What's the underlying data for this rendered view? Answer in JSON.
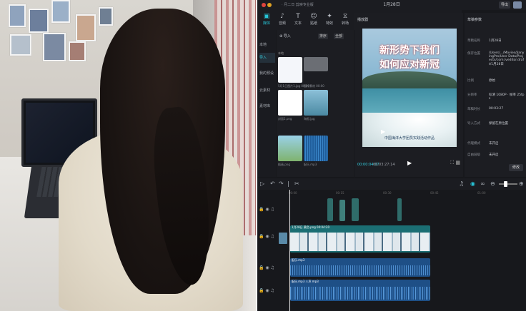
{
  "editor": {
    "window_title": "1月28日",
    "menu_text": "· 月二日  剪映专业版",
    "export_label": "导出",
    "colors": {
      "accent": "#27c3d6",
      "panel": "#1c1d22",
      "bg": "#17181c",
      "track_video": "#1b6e73",
      "track_audio": "#1e4f86"
    },
    "toolbar": {
      "items": [
        {
          "icon": "media-icon",
          "label": "媒体"
        },
        {
          "icon": "audio-icon",
          "label": "音频"
        },
        {
          "icon": "text-icon",
          "label": "文本"
        },
        {
          "icon": "sticker-icon",
          "label": "贴纸"
        },
        {
          "icon": "effects-icon",
          "label": "特效"
        },
        {
          "icon": "transition-icon",
          "label": "转场"
        },
        {
          "icon": "filter-icon",
          "label": "滤镜"
        },
        {
          "icon": "adjust-icon",
          "label": "调节"
        },
        {
          "icon": "template-icon",
          "label": "模板"
        }
      ]
    },
    "leftnav": {
      "items": [
        "本地",
        "导入",
        "我的预设",
        "云素材",
        "素材库"
      ]
    },
    "media": {
      "import_label": "导入",
      "btn_sort": "排序",
      "btn_all": "全部",
      "section": "本地",
      "thumbs": [
        {
          "caption": "5月1日图片1.jpg 00:00"
        },
        {
          "caption": "图片素材 00:00"
        },
        {
          "caption": "封面2.png"
        },
        {
          "caption": "海报.jpg"
        },
        {
          "caption": "插画.png"
        },
        {
          "caption": "配乐.mp3"
        }
      ]
    },
    "player": {
      "title": "播放器",
      "headline1": "新形势下我们",
      "headline2": "如何应对新冠",
      "subtitle": "中国海洋大学团员实践活动作品",
      "timecode_current": "00:00:04:07",
      "timecode_total": "00:03:27:14"
    },
    "props": {
      "title": "草稿参数",
      "rows": [
        {
          "k": "草稿名称",
          "v": "1月28日"
        },
        {
          "k": "保存位置",
          "v": "/Users/.../Movies/JianyingPro/User Data/Projects/com.lveditor.draft/1月28日"
        },
        {
          "k": "比例",
          "v": "原始"
        },
        {
          "k": "分辨率",
          "v": "标清 1080P · 帧率 25fps"
        },
        {
          "k": "草稿时长",
          "v": "00:03:27"
        },
        {
          "k": "导入方式",
          "v": "保留在原位置"
        },
        {
          "k": "代理模式",
          "v": "未开启"
        },
        {
          "k": "自由层级",
          "v": "未开启"
        }
      ],
      "modify_label": "修改"
    },
    "timeline": {
      "tools": [
        "▷",
        "↶",
        "↷",
        "|",
        "✂"
      ],
      "ruler_labels": [
        "00:00",
        "00:15",
        "00:30",
        "00:45",
        "01:00"
      ],
      "tracks": [
        {
          "name": "T1",
          "clip": "1月28日 黄色.png  00:04:20"
        },
        {
          "name": "T2",
          "clip": "配乐.mp3"
        },
        {
          "name": "T3",
          "clip": "配乐.mp3  人声.mp3"
        }
      ]
    }
  }
}
